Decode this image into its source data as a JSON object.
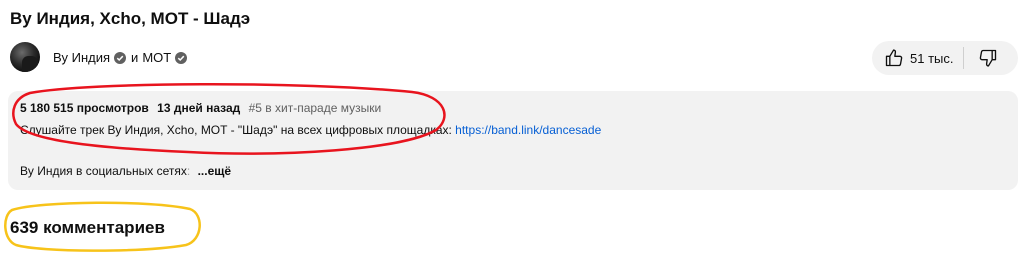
{
  "video": {
    "title": "Ву Индия, Xcho, MOT - Шадэ"
  },
  "channel": {
    "name_1": "Ву Индия",
    "joiner": "и",
    "name_2": "MOT",
    "verified_icon": "verified-check-icon"
  },
  "actions": {
    "like_icon": "thumbs-up-icon",
    "like_count": "51 тыс.",
    "dislike_icon": "thumbs-down-icon"
  },
  "description": {
    "views": "5 180 515 просмотров",
    "date": "13 дней назад",
    "rank": "#5 в хит-параде музыки",
    "text_prefix": "Слушайте трек Ву Индия, Xcho, MOT - \"Шадэ\" на всех цифровых площадках: ",
    "link": "https://band.link/dancesade",
    "social_text": "Ву Индия в социальных сетях",
    "social_fade": ":",
    "more_label": "...ещё"
  },
  "comments": {
    "count_label": "639 комментариев"
  },
  "colors": {
    "link": "#065fd4",
    "annotation_red": "#e8141e",
    "annotation_yellow": "#f7c31a",
    "pill_background": "#f2f2f2"
  }
}
